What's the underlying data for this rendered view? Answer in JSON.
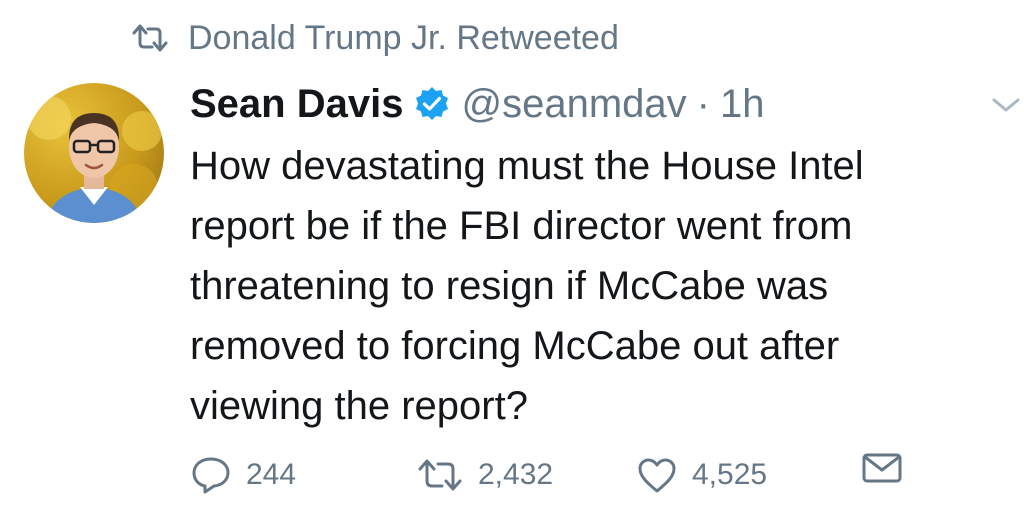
{
  "retweet_context": {
    "icon": "retweet-icon",
    "text": "Donald Trump Jr. Retweeted"
  },
  "author": {
    "display_name": "Sean Davis",
    "verified": true,
    "handle": "@seanmdav",
    "separator": "·",
    "time": "1h"
  },
  "tweet": {
    "lines": [
      "How devastating must the House Intel",
      "report be if the FBI director went from",
      "threatening to resign if McCabe was",
      "removed to forcing McCabe out after",
      "viewing the report?"
    ]
  },
  "actions": {
    "reply_count": "244",
    "retweet_count": "2,432",
    "like_count": "4,525"
  },
  "colors": {
    "verified_blue": "#1da1f2",
    "muted_gray": "#657786",
    "text": "#14171a"
  }
}
